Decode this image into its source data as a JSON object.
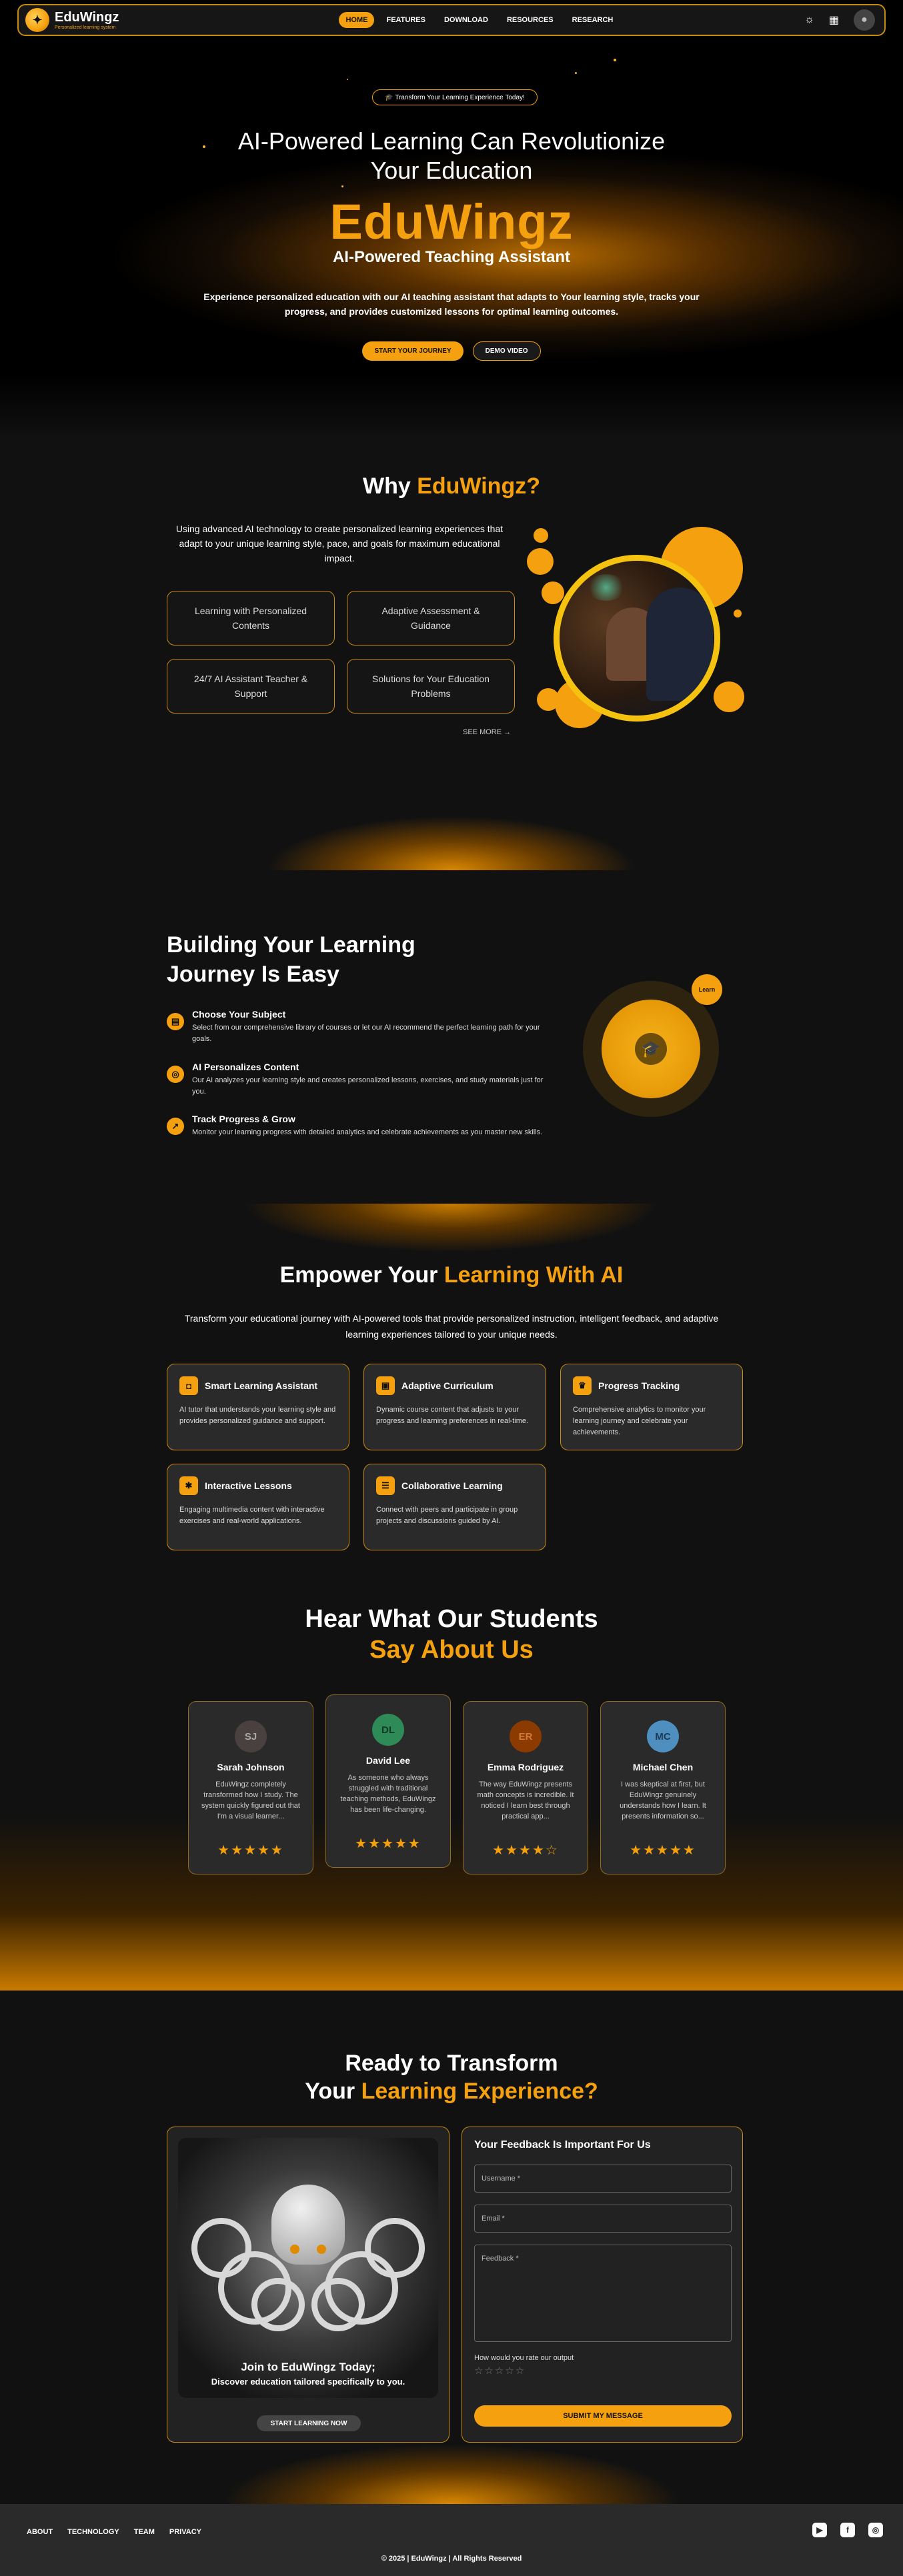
{
  "nav": {
    "brand": "EduWingz",
    "tagline": "Personalized learning system",
    "links": [
      "HOME",
      "FEATURES",
      "DOWNLOAD",
      "RESOURCES",
      "RESEARCH"
    ],
    "icons": [
      "sun-icon",
      "grid-icon",
      "user-avatar-icon"
    ]
  },
  "hero": {
    "pill": "🎓 Transform Your Learning Experience Today!",
    "title_line1": "AI-Powered Learning Can Revolutionize",
    "title_line2": "Your Education",
    "brand": "EduWingz",
    "subtitle": "AI-Powered Teaching Assistant",
    "desc": "Experience personalized education with our AI teaching assistant that adapts to Your learning style, tracks your progress, and provides customized lessons for optimal learning outcomes.",
    "btn_primary": "START YOUR JOURNEY",
    "btn_secondary": "DEMO VIDEO"
  },
  "why": {
    "title_prefix": "Why ",
    "title_accent": "EduWingz?",
    "desc": "Using advanced AI technology to create personalized learning experiences that adapt to your unique learning style, pace, and goals for maximum educational impact.",
    "cards": [
      "Learning with Personalized Contents",
      "Adaptive Assessment & Guidance",
      "24/7 AI Assistant Teacher & Support",
      "Solutions for Your Education Problems"
    ],
    "see_more": "SEE MORE"
  },
  "journey": {
    "title_line1": "Building Your Learning",
    "title_line2": "Journey Is Easy",
    "steps": [
      {
        "title": "Choose Your Subject",
        "desc": "Select from our comprehensive library of courses or let our AI recommend the perfect learning path for your goals."
      },
      {
        "title": "AI Personalizes Content",
        "desc": "Our AI analyzes your learning style and creates personalized lessons, exercises, and study materials just for you."
      },
      {
        "title": "Track Progress & Grow",
        "desc": "Monitor your learning progress with detailed analytics and celebrate achievements as you master new skills."
      }
    ],
    "badge": "Learn"
  },
  "empower": {
    "title_prefix": "Empower Your ",
    "title_accent": "Learning With AI",
    "desc": "Transform your educational journey with AI-powered tools that provide personalized instruction, intelligent feedback, and adaptive learning experiences tailored to your unique needs.",
    "cards": [
      {
        "title": "Smart Learning Assistant",
        "desc": "AI tutor that understands your learning style and provides personalized guidance and support.",
        "icon": "robot-icon"
      },
      {
        "title": "Adaptive Curriculum",
        "desc": "Dynamic course content that adjusts to your progress and learning preferences in real-time.",
        "icon": "curriculum-icon"
      },
      {
        "title": "Progress Tracking",
        "desc": "Comprehensive analytics to monitor your learning journey and celebrate your achievements.",
        "icon": "trophy-icon"
      },
      {
        "title": "Interactive Lessons",
        "desc": "Engaging multimedia content with interactive exercises and real-world applications.",
        "icon": "lightbulb-icon"
      },
      {
        "title": "Collaborative Learning",
        "desc": "Connect with peers and participate in group projects and discussions guided by AI.",
        "icon": "group-icon"
      }
    ]
  },
  "testimonials": {
    "title_line1": "Hear What Our Students",
    "title_line2": "Say About Us",
    "items": [
      {
        "initials": "SJ",
        "name": "Sarah Johnson",
        "quote": "EduWingz completely transformed how I study. The system quickly figured out that I'm a visual learner...",
        "stars": "★★★★★",
        "color": "#4a4040"
      },
      {
        "initials": "DL",
        "name": "David Lee",
        "quote": "As someone who always struggled with traditional teaching methods, EduWingz has been life-changing.",
        "stars": "★★★★★",
        "color": "#2e8b57"
      },
      {
        "initials": "ER",
        "name": "Emma Rodriguez",
        "quote": "The way EduWingz presents math concepts is incredible. It noticed I learn best through practical app...",
        "stars": "★★★★☆",
        "color": "#8b3a00"
      },
      {
        "initials": "MC",
        "name": "Michael Chen",
        "quote": "I was skeptical at first, but EduWingz genuinely understands how I learn. It presents information so...",
        "stars": "★★★★★",
        "color": "#4f8fc0"
      }
    ]
  },
  "ready": {
    "title_line1": "Ready to Transform",
    "title_prefix": "Your ",
    "title_accent": "Learning Experience?",
    "join_title": "Join to EduWingz Today;",
    "join_desc": "Discover education tailored specifically to you.",
    "join_btn": "START LEARNING NOW",
    "feedback_title": "Your Feedback Is Important For Us",
    "username_ph": "Username *",
    "email_ph": "Email *",
    "feedback_ph": "Feedback *",
    "rate_label": "How would you rate our output",
    "rate_stars": "☆☆☆☆☆",
    "submit": "SUBMIT MY MESSAGE"
  },
  "footer": {
    "links": [
      "ABOUT",
      "TECHNOLOGY",
      "TEAM",
      "PRIVACY"
    ],
    "social": [
      "youtube-icon",
      "facebook-icon",
      "instagram-icon"
    ],
    "copyright": "© 2025 | EduWingz | All Rights Reserved"
  },
  "colors": {
    "accent": "#F5A10F",
    "background": "#111111",
    "card": "#2a2a2a"
  }
}
